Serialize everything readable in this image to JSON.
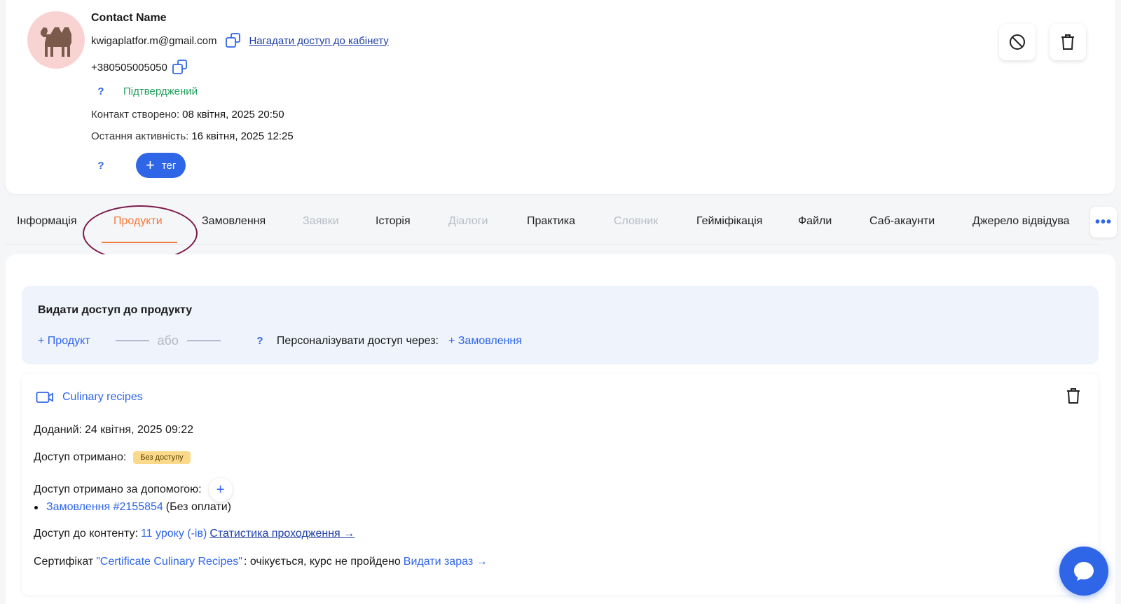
{
  "contact": {
    "name": "Contact Name",
    "email": "kwigaplatfor.m@gmail.com",
    "remind_link": "Нагадати доступ до кабінету",
    "phone": "+380505005050",
    "help_mark": "?",
    "status": "Підтверджений",
    "created_label": "Контакт створено:",
    "created_value": "08 квітня, 2025 20:50",
    "activity_label": "Остання активність:",
    "activity_value": "16 квітня, 2025 12:25",
    "tag_button": "тег",
    "tag_plus": "+"
  },
  "tabs": [
    {
      "label": "Інформація",
      "state": "normal"
    },
    {
      "label": "Продукти",
      "state": "active"
    },
    {
      "label": "Замовлення",
      "state": "normal"
    },
    {
      "label": "Заявки",
      "state": "disabled"
    },
    {
      "label": "Історія",
      "state": "normal"
    },
    {
      "label": "Діалоги",
      "state": "disabled"
    },
    {
      "label": "Практика",
      "state": "normal"
    },
    {
      "label": "Словник",
      "state": "disabled"
    },
    {
      "label": "Гейміфікація",
      "state": "normal"
    },
    {
      "label": "Файли",
      "state": "normal"
    },
    {
      "label": "Саб-акаунти",
      "state": "normal"
    },
    {
      "label": "Джерело відвідува",
      "state": "normal"
    }
  ],
  "tabs_more": "•••",
  "grant": {
    "title": "Видати доступ до продукту",
    "add_product": "+ Продукт",
    "or": "або",
    "help_mark": "?",
    "personalize_label": "Персоналізувати доступ через:",
    "add_order": "+ Замовлення"
  },
  "product": {
    "name": "Culinary recipes",
    "added_label": "Доданий:",
    "added_value": "24 квітня, 2025 09:22",
    "access_label": "Доступ отримано:",
    "access_badge": "Без доступу",
    "via_label": "Доступ отримано за допомогою:",
    "via_plus": "+",
    "order_link": "Замовлення #2155854",
    "order_note": "(Без оплати)",
    "content_label": "Доступ до контенту:",
    "content_lessons": "11 уроку (-ів)",
    "content_stats": "Статистика проходження →",
    "cert_label": "Сертифікат",
    "cert_name": "\"Certificate Culinary Recipes\"",
    "cert_status": ": очікується, курс не пройдено",
    "cert_issue": "Видати зараз →"
  },
  "colors": {
    "accent": "#2f66e8",
    "active_tab": "#f07a3a",
    "confirmed": "#1f9d5a",
    "badge_bg": "#fbd98a",
    "avatar_bg": "#f9d2d2"
  }
}
